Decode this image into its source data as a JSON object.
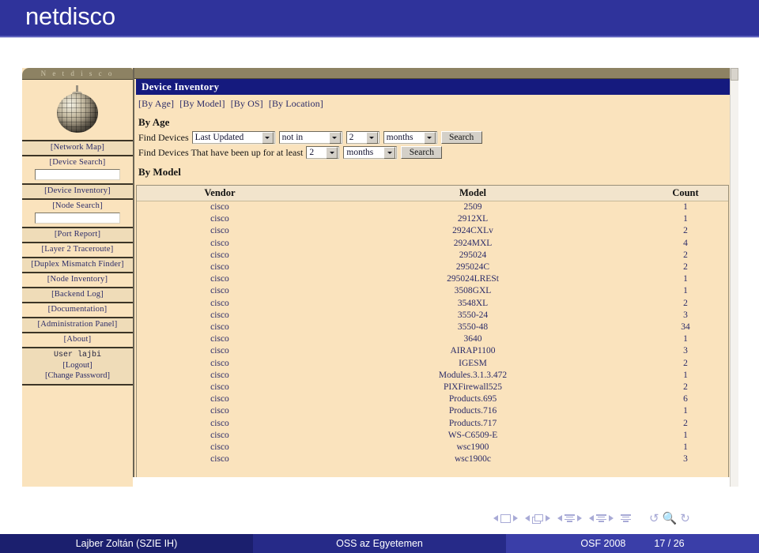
{
  "slide": {
    "title": "netdisco"
  },
  "netdisco": {
    "sidebar": {
      "header": "N e t d i s c o",
      "logo_icon": "disco-ball-icon",
      "items": [
        {
          "label": "[Network Map]",
          "has_field": false
        },
        {
          "label": "[Device Search]",
          "has_field": true,
          "field_value": ""
        },
        {
          "label": "[Device Inventory]",
          "has_field": false
        },
        {
          "label": "[Node Search]",
          "has_field": true,
          "field_value": ""
        },
        {
          "label": "[Port Report]",
          "has_field": false
        },
        {
          "label": "[Layer 2 Traceroute]",
          "has_field": false
        },
        {
          "label": "[Duplex Mismatch Finder]",
          "has_field": false
        },
        {
          "label": "[Node Inventory]",
          "has_field": false
        },
        {
          "label": "[Backend Log]",
          "has_field": false
        },
        {
          "label": "[Documentation]",
          "has_field": false
        },
        {
          "label": "[Administration Panel]",
          "has_field": false
        },
        {
          "label": "[About]",
          "has_field": false
        }
      ],
      "user": {
        "user_line": "User lajbi",
        "logout": "[Logout]",
        "change_password": "[Change Password]"
      }
    },
    "main": {
      "banner": "Device Inventory",
      "tabs": [
        "[By Age]",
        "[By Model]",
        "[By OS]",
        "[By Location]"
      ],
      "by_age": {
        "heading": "By Age",
        "row1": {
          "label": "Find Devices",
          "field_select": "Last Updated",
          "op_select": "not in",
          "num_select": "2",
          "unit_select": "months",
          "search_button": "Search"
        },
        "row2": {
          "label": "Find Devices That have been up for at least",
          "num_select": "2",
          "unit_select": "months",
          "search_button": "Search"
        }
      },
      "by_model": {
        "heading": "By Model",
        "columns": [
          "Vendor",
          "Model",
          "Count"
        ],
        "rows": [
          {
            "vendor": "cisco",
            "model": "2509",
            "count": "1"
          },
          {
            "vendor": "cisco",
            "model": "2912XL",
            "count": "1"
          },
          {
            "vendor": "cisco",
            "model": "2924CXLv",
            "count": "2"
          },
          {
            "vendor": "cisco",
            "model": "2924MXL",
            "count": "4"
          },
          {
            "vendor": "cisco",
            "model": "295024",
            "count": "2"
          },
          {
            "vendor": "cisco",
            "model": "295024C",
            "count": "2"
          },
          {
            "vendor": "cisco",
            "model": "295024LRESt",
            "count": "1"
          },
          {
            "vendor": "cisco",
            "model": "3508GXL",
            "count": "1"
          },
          {
            "vendor": "cisco",
            "model": "3548XL",
            "count": "2"
          },
          {
            "vendor": "cisco",
            "model": "3550-24",
            "count": "3"
          },
          {
            "vendor": "cisco",
            "model": "3550-48",
            "count": "34"
          },
          {
            "vendor": "cisco",
            "model": "3640",
            "count": "1"
          },
          {
            "vendor": "cisco",
            "model": "AIRAP1100",
            "count": "3"
          },
          {
            "vendor": "cisco",
            "model": "IGESM",
            "count": "2"
          },
          {
            "vendor": "cisco",
            "model": "Modules.3.1.3.472",
            "count": "1"
          },
          {
            "vendor": "cisco",
            "model": "PIXFirewall525",
            "count": "2"
          },
          {
            "vendor": "cisco",
            "model": "Products.695",
            "count": "6"
          },
          {
            "vendor": "cisco",
            "model": "Products.716",
            "count": "1"
          },
          {
            "vendor": "cisco",
            "model": "Products.717",
            "count": "2"
          },
          {
            "vendor": "cisco",
            "model": "WS-C6509-E",
            "count": "1"
          },
          {
            "vendor": "cisco",
            "model": "wsc1900",
            "count": "1"
          },
          {
            "vendor": "cisco",
            "model": "wsc1900c",
            "count": "3"
          }
        ]
      }
    }
  },
  "footer": {
    "author": "Lajber Zoltán  (SZIE IH)",
    "talk": "OSS az Egyetemen",
    "event": "OSF 2008",
    "page": "17 / 26"
  },
  "colors": {
    "title_bar": "#2f339b",
    "banner": "#151a7e",
    "sidebar_bg": "#fae3bd",
    "link_text": "#2b2b68"
  }
}
